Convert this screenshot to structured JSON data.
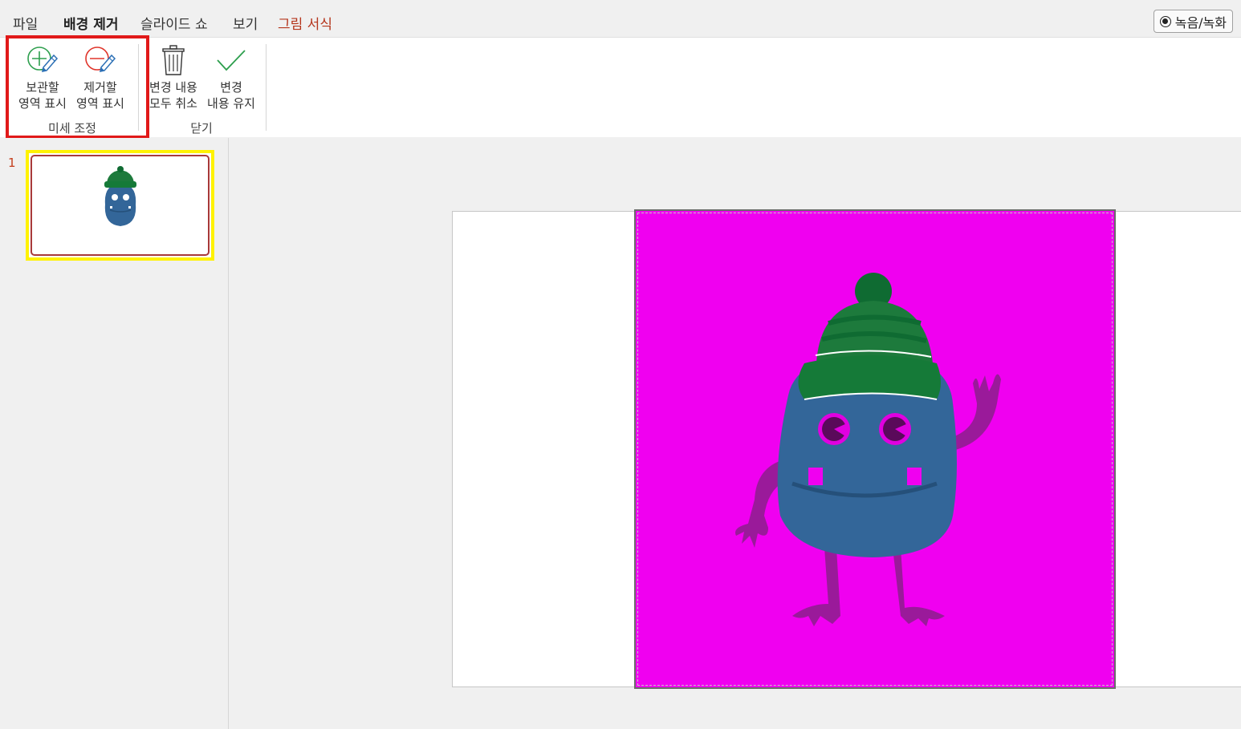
{
  "tabs": {
    "file": "파일",
    "remove_background": "배경 제거",
    "slideshow": "슬라이드 쇼",
    "view": "보기",
    "picture_format": "그림 서식"
  },
  "record_button": {
    "label": "녹음/녹화"
  },
  "ribbon": {
    "refine_group": {
      "label": "미세 조정",
      "mark_keep_label": "보관할\n영역 표시",
      "mark_remove_label": "제거할\n영역 표시"
    },
    "close_group": {
      "label": "닫기",
      "discard_label": "변경 내용\n모두 취소",
      "keep_label": "변경\n내용 유지"
    }
  },
  "slides_pane": {
    "slide_number": "1"
  },
  "colors": {
    "accent": "#c43e1c",
    "highlight_red": "#e11919",
    "thumb_yellow": "#fff200",
    "magenta": "#f000f0"
  },
  "icons": [
    "plus-pencil-icon",
    "minus-pencil-icon",
    "trash-icon",
    "checkmark-icon",
    "record-icon"
  ]
}
